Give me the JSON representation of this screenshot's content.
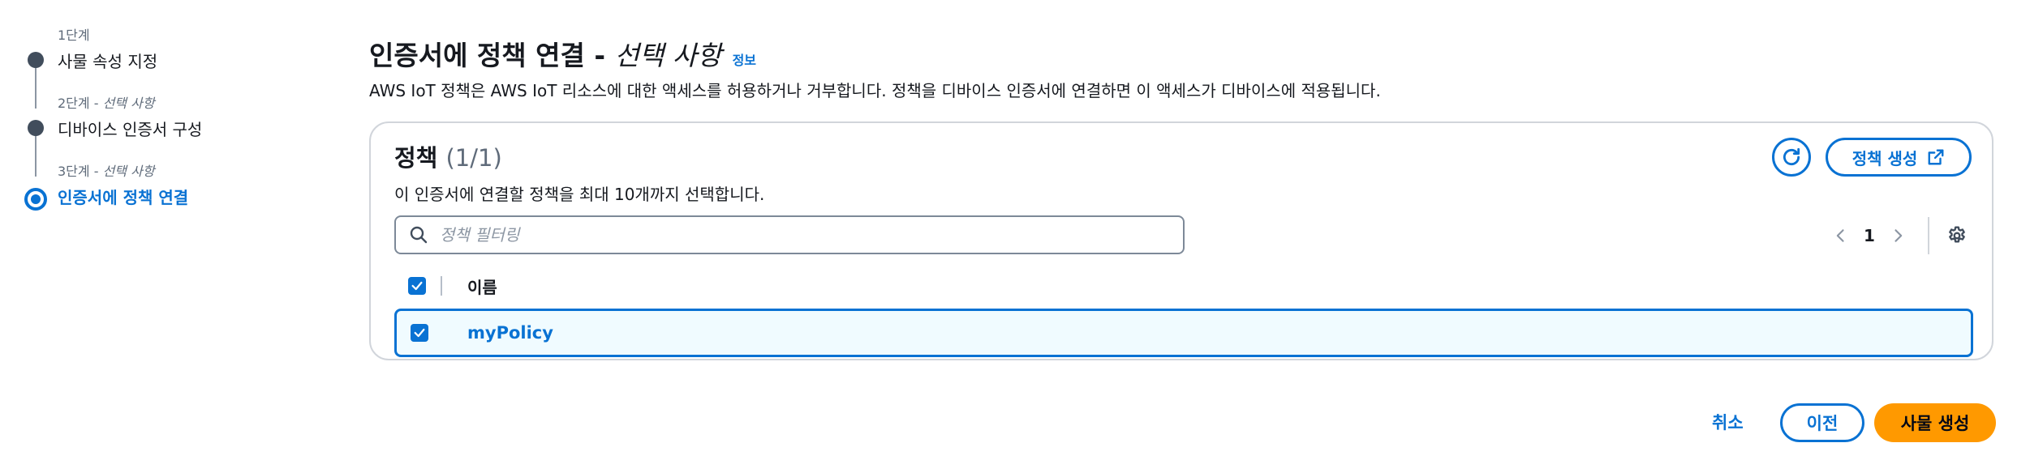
{
  "stepper": {
    "steps": [
      {
        "sub_label": "1단계",
        "sub_optional": "",
        "title": "사물 속성 지정"
      },
      {
        "sub_label": "2단계 - ",
        "sub_optional": "선택 사항",
        "title": "디바이스 인증서 구성"
      },
      {
        "sub_label": "3단계 - ",
        "sub_optional": "선택 사항",
        "title": "인증서에 정책 연결"
      }
    ]
  },
  "header": {
    "title": "인증서에 정책 연결 - ",
    "title_optional": "선택 사항",
    "info_link": "정보",
    "description": "AWS IoT 정책은 AWS IoT 리소스에 대한 액세스를 허용하거나 거부합니다. 정책을 디바이스 인증서에 연결하면 이 액세스가 디바이스에 적용됩니다."
  },
  "policies": {
    "title": "정책",
    "count": "(1/1)",
    "description": "이 인증서에 연결할 정책을 최대 10개까지 선택합니다.",
    "create_label": "정책 생성",
    "search_placeholder": "정책 필터링",
    "pagination": {
      "page": "1"
    },
    "column_name": "이름",
    "rows": [
      {
        "name": "myPolicy",
        "selected": true
      }
    ]
  },
  "footer": {
    "cancel": "취소",
    "previous": "이전",
    "create_thing": "사물 생성"
  },
  "colors": {
    "accent": "#0972d3",
    "primary_button": "#ff9900",
    "selected_row_bg": "#f0fbff"
  },
  "icons": [
    "refresh-icon",
    "external-link-icon",
    "search-icon",
    "chevron-left-icon",
    "chevron-right-icon",
    "gear-icon",
    "checkmark-icon"
  ]
}
